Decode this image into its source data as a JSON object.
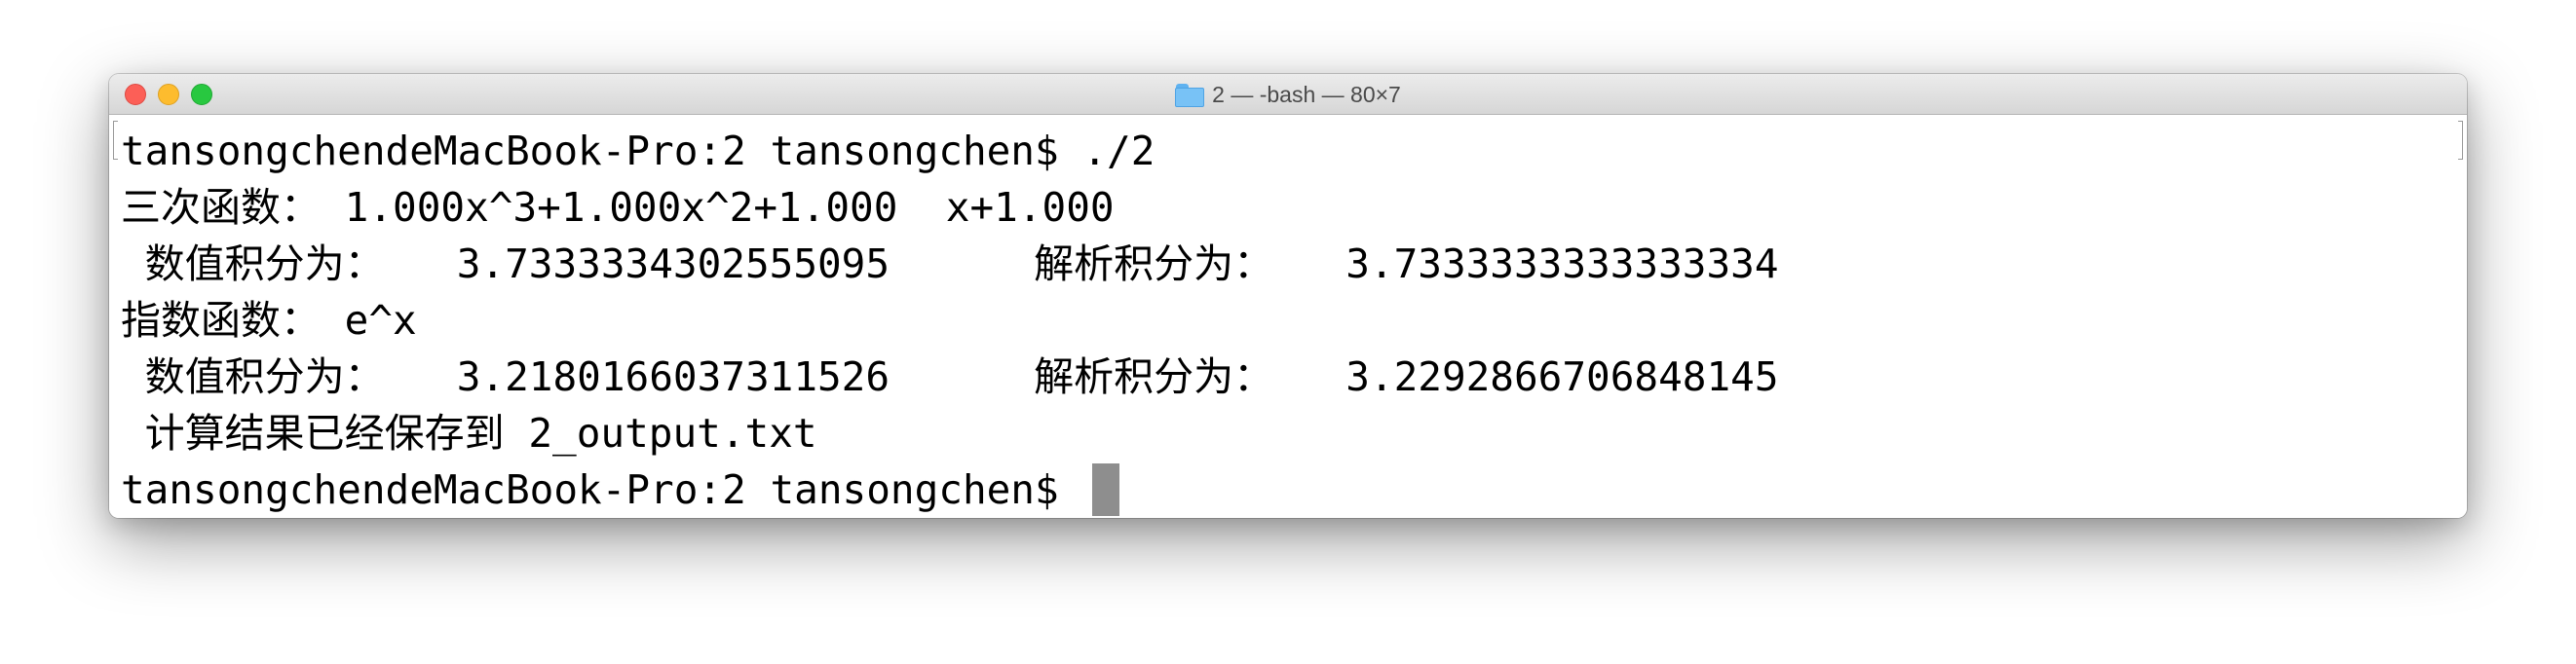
{
  "window": {
    "title": "2 — -bash — 80×7",
    "title_icon": "folder-icon",
    "traffic_lights": {
      "close_color": "#fc5f57",
      "minimize_color": "#fdbc2e",
      "zoom_color": "#28c840"
    }
  },
  "terminal": {
    "lines": [
      "tansongchendeMacBook-Pro:2 tansongchen$ ./2",
      "三次函数： 1.000x^3+1.000x^2+1.000  x+1.000",
      " 数值积分为：   3.7333334302555095      解析积分为：   3.7333333333333334",
      "指数函数： e^x",
      " 数值积分为：   3.2180166037311526      解析积分为：   3.2292866706848145",
      " 计算结果已经保存到 2_output.txt",
      "tansongchendeMacBook-Pro:2 tansongchen$ "
    ],
    "cursor_color": "#8e8e8e"
  }
}
